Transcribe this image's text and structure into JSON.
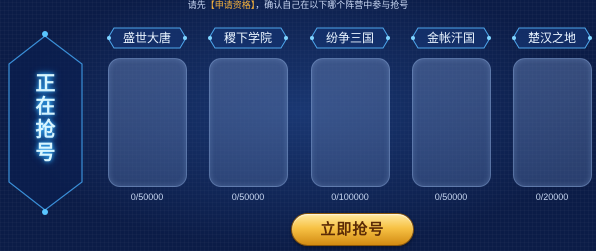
{
  "notice": {
    "prefix": "请先",
    "highlight": "【申请资格】",
    "suffix": "，确认自己在以下哪个阵营中参与抢号"
  },
  "status_badge": {
    "lines": [
      "正",
      "在",
      "抢",
      "号"
    ]
  },
  "camps": [
    {
      "name": "盛世大唐",
      "count": "0/50000"
    },
    {
      "name": "稷下学院",
      "count": "0/50000"
    },
    {
      "name": "纷争三国",
      "count": "0/100000"
    },
    {
      "name": "金帐汗国",
      "count": "0/50000"
    },
    {
      "name": "楚汉之地",
      "count": "0/20000"
    }
  ],
  "grab_button": {
    "label": "立即抢号"
  },
  "colors": {
    "background": "#0b1c47",
    "highlight": "#f4b13c",
    "button_gold": "#f7c245",
    "glow": "#39b7ff"
  }
}
